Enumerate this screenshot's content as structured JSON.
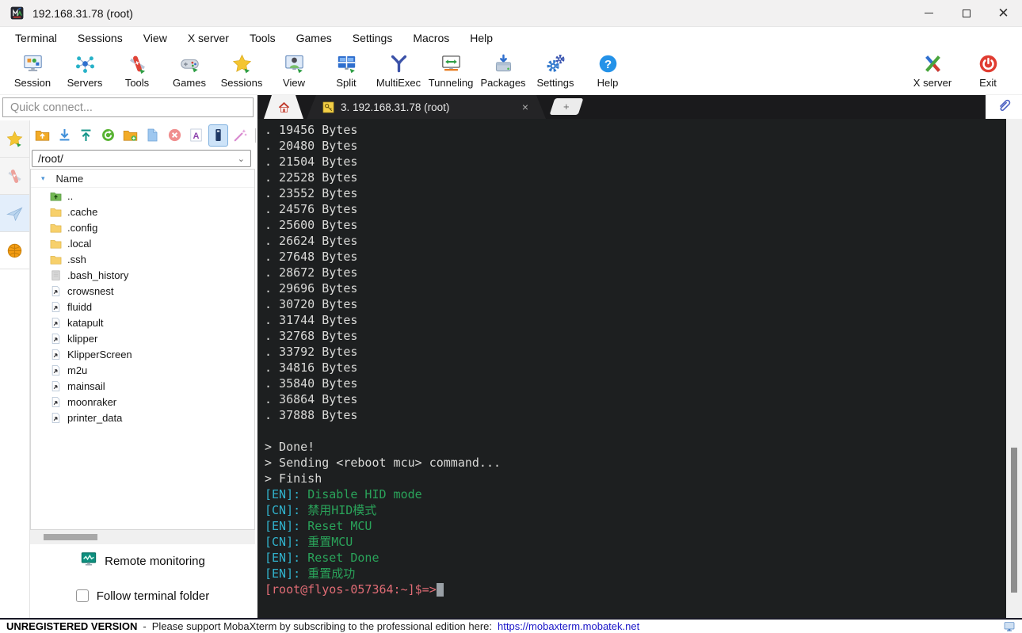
{
  "window": {
    "title": "192.168.31.78 (root)"
  },
  "menubar": {
    "items": [
      "Terminal",
      "Sessions",
      "View",
      "X server",
      "Tools",
      "Games",
      "Settings",
      "Macros",
      "Help"
    ]
  },
  "toolbar": {
    "items": [
      {
        "label": "Session",
        "icon": "session"
      },
      {
        "label": "Servers",
        "icon": "servers"
      },
      {
        "label": "Tools",
        "icon": "tools"
      },
      {
        "label": "Games",
        "icon": "games"
      },
      {
        "label": "Sessions",
        "icon": "star"
      },
      {
        "label": "View",
        "icon": "view"
      },
      {
        "label": "Split",
        "icon": "split"
      },
      {
        "label": "MultiExec",
        "icon": "multiexec"
      },
      {
        "label": "Tunneling",
        "icon": "tunneling"
      },
      {
        "label": "Packages",
        "icon": "packages"
      },
      {
        "label": "Settings",
        "icon": "settings"
      },
      {
        "label": "Help",
        "icon": "help"
      }
    ],
    "right_items": [
      {
        "label": "X server",
        "icon": "xserver"
      },
      {
        "label": "Exit",
        "icon": "exit"
      }
    ]
  },
  "quick_connect": {
    "placeholder": "Quick connect..."
  },
  "sidebar": {
    "tabs": [
      {
        "name": "sessions",
        "icon": "star"
      },
      {
        "name": "tools",
        "icon": "knife"
      },
      {
        "name": "macros",
        "icon": "paper-plane"
      },
      {
        "name": "sftp",
        "icon": "globe",
        "active": true
      }
    ]
  },
  "sftp": {
    "toolbar": [
      {
        "name": "parent-directory",
        "icon": "folder-up"
      },
      {
        "name": "download",
        "icon": "download"
      },
      {
        "name": "upload",
        "icon": "upload"
      },
      {
        "name": "refresh",
        "icon": "refresh"
      },
      {
        "name": "new-folder",
        "icon": "folder-new"
      },
      {
        "name": "new-file",
        "icon": "file-new"
      },
      {
        "name": "delete",
        "icon": "delete"
      },
      {
        "name": "edit-file",
        "icon": "font-a"
      },
      {
        "name": "file-editor",
        "icon": "edit-active",
        "active": true
      },
      {
        "name": "follow-wand",
        "icon": "wand"
      }
    ],
    "path": "/root/",
    "column_header": "Name",
    "files": [
      {
        "name": "..",
        "icon": "updir"
      },
      {
        "name": ".cache",
        "icon": "folder"
      },
      {
        "name": ".config",
        "icon": "folder"
      },
      {
        "name": ".local",
        "icon": "folder"
      },
      {
        "name": ".ssh",
        "icon": "folder"
      },
      {
        "name": ".bash_history",
        "icon": "file"
      },
      {
        "name": "crowsnest",
        "icon": "link"
      },
      {
        "name": "fluidd",
        "icon": "link"
      },
      {
        "name": "katapult",
        "icon": "link"
      },
      {
        "name": "klipper",
        "icon": "link"
      },
      {
        "name": "KlipperScreen",
        "icon": "link"
      },
      {
        "name": "m2u",
        "icon": "link"
      },
      {
        "name": "mainsail",
        "icon": "link"
      },
      {
        "name": "moonraker",
        "icon": "link"
      },
      {
        "name": "printer_data",
        "icon": "link"
      }
    ],
    "remote_monitoring_label": "Remote monitoring",
    "follow_terminal_folder_label": "Follow terminal folder",
    "follow_checked": false
  },
  "tabs": {
    "session": {
      "label": "3. 192.168.31.78 (root)",
      "close_glyph": "×"
    },
    "new_tab_glyph": "+"
  },
  "terminal": {
    "colors": {
      "bg": "#1d1f20",
      "fg": "#d9d9d7",
      "cyan": "#31b2cc",
      "green": "#2aa35a",
      "red": "#e06c75",
      "cursor": "#9aa0a6"
    },
    "lines": [
      {
        "segments": [
          {
            "text": ". 19456 Bytes",
            "color": "fg"
          }
        ]
      },
      {
        "segments": [
          {
            "text": ". 20480 Bytes",
            "color": "fg"
          }
        ]
      },
      {
        "segments": [
          {
            "text": ". 21504 Bytes",
            "color": "fg"
          }
        ]
      },
      {
        "segments": [
          {
            "text": ". 22528 Bytes",
            "color": "fg"
          }
        ]
      },
      {
        "segments": [
          {
            "text": ". 23552 Bytes",
            "color": "fg"
          }
        ]
      },
      {
        "segments": [
          {
            "text": ". 24576 Bytes",
            "color": "fg"
          }
        ]
      },
      {
        "segments": [
          {
            "text": ". 25600 Bytes",
            "color": "fg"
          }
        ]
      },
      {
        "segments": [
          {
            "text": ". 26624 Bytes",
            "color": "fg"
          }
        ]
      },
      {
        "segments": [
          {
            "text": ". 27648 Bytes",
            "color": "fg"
          }
        ]
      },
      {
        "segments": [
          {
            "text": ". 28672 Bytes",
            "color": "fg"
          }
        ]
      },
      {
        "segments": [
          {
            "text": ". 29696 Bytes",
            "color": "fg"
          }
        ]
      },
      {
        "segments": [
          {
            "text": ". 30720 Bytes",
            "color": "fg"
          }
        ]
      },
      {
        "segments": [
          {
            "text": ". 31744 Bytes",
            "color": "fg"
          }
        ]
      },
      {
        "segments": [
          {
            "text": ". 32768 Bytes",
            "color": "fg"
          }
        ]
      },
      {
        "segments": [
          {
            "text": ". 33792 Bytes",
            "color": "fg"
          }
        ]
      },
      {
        "segments": [
          {
            "text": ". 34816 Bytes",
            "color": "fg"
          }
        ]
      },
      {
        "segments": [
          {
            "text": ". 35840 Bytes",
            "color": "fg"
          }
        ]
      },
      {
        "segments": [
          {
            "text": ". 36864 Bytes",
            "color": "fg"
          }
        ]
      },
      {
        "segments": [
          {
            "text": ". 37888 Bytes",
            "color": "fg"
          }
        ]
      },
      {
        "segments": []
      },
      {
        "segments": [
          {
            "text": "> Done!",
            "color": "fg"
          }
        ]
      },
      {
        "segments": [
          {
            "text": "> Sending <reboot mcu> command...",
            "color": "fg"
          }
        ]
      },
      {
        "segments": [
          {
            "text": "> Finish",
            "color": "fg"
          }
        ]
      },
      {
        "segments": [
          {
            "text": "[EN]: ",
            "color": "cyan"
          },
          {
            "text": "Disable HID mode",
            "color": "green"
          }
        ]
      },
      {
        "segments": [
          {
            "text": "[CN]: ",
            "color": "cyan"
          },
          {
            "text": "禁用HID模式",
            "color": "green"
          }
        ]
      },
      {
        "segments": [
          {
            "text": "[EN]: ",
            "color": "cyan"
          },
          {
            "text": "Reset MCU",
            "color": "green"
          }
        ]
      },
      {
        "segments": [
          {
            "text": "[CN]: ",
            "color": "cyan"
          },
          {
            "text": "重置MCU",
            "color": "green"
          }
        ]
      },
      {
        "segments": [
          {
            "text": "[EN]: ",
            "color": "cyan"
          },
          {
            "text": "Reset Done",
            "color": "green"
          }
        ]
      },
      {
        "segments": [
          {
            "text": "[EN]: ",
            "color": "cyan"
          },
          {
            "text": "重置成功",
            "color": "green"
          }
        ]
      },
      {
        "segments": [
          {
            "text": "[root@flyos-057364:~]$=>",
            "color": "red"
          }
        ],
        "cursor": true
      }
    ]
  },
  "statusbar": {
    "version": "UNREGISTERED VERSION",
    "separator": "-",
    "message": "Please support MobaXterm by subscribing to the professional edition here:",
    "link": "https://mobaxterm.mobatek.net",
    "link_color": "#1a15c8"
  }
}
